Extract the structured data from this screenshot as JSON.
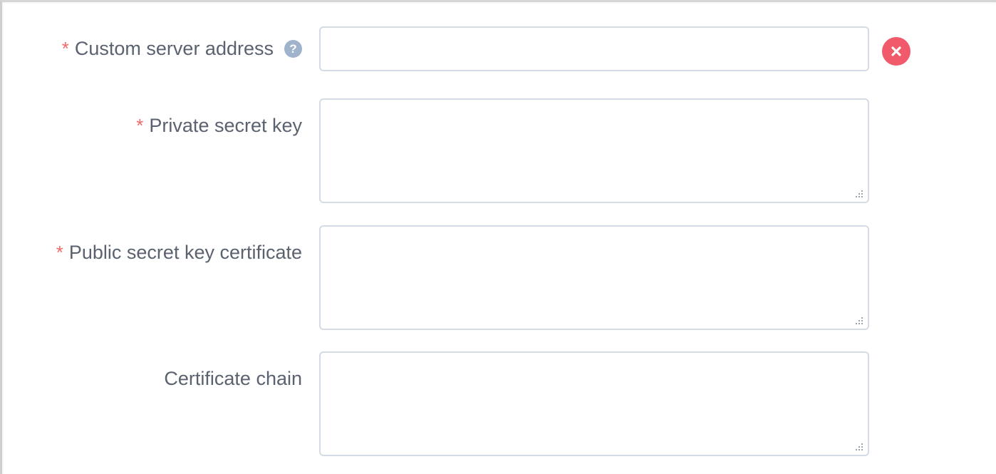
{
  "form": {
    "required_marker": "*",
    "fields": [
      {
        "label": "Custom server address",
        "value": "",
        "required": true,
        "has_help": true
      },
      {
        "label": "Private secret key",
        "value": "",
        "required": true
      },
      {
        "label": "Public secret key certificate",
        "value": "",
        "required": true
      },
      {
        "label": "Certificate chain",
        "value": "",
        "required": false
      }
    ],
    "help_glyph": "?",
    "icons": {
      "help": "question-circle-icon",
      "clear": "close-circle-icon",
      "resize": "resize-grip-icon"
    }
  },
  "colors": {
    "required": "#f06a6a",
    "label": "#5a6270",
    "input_border": "#d5dbe4",
    "clear_button": "#f05a6a",
    "help_icon": "#9fb3cc"
  }
}
